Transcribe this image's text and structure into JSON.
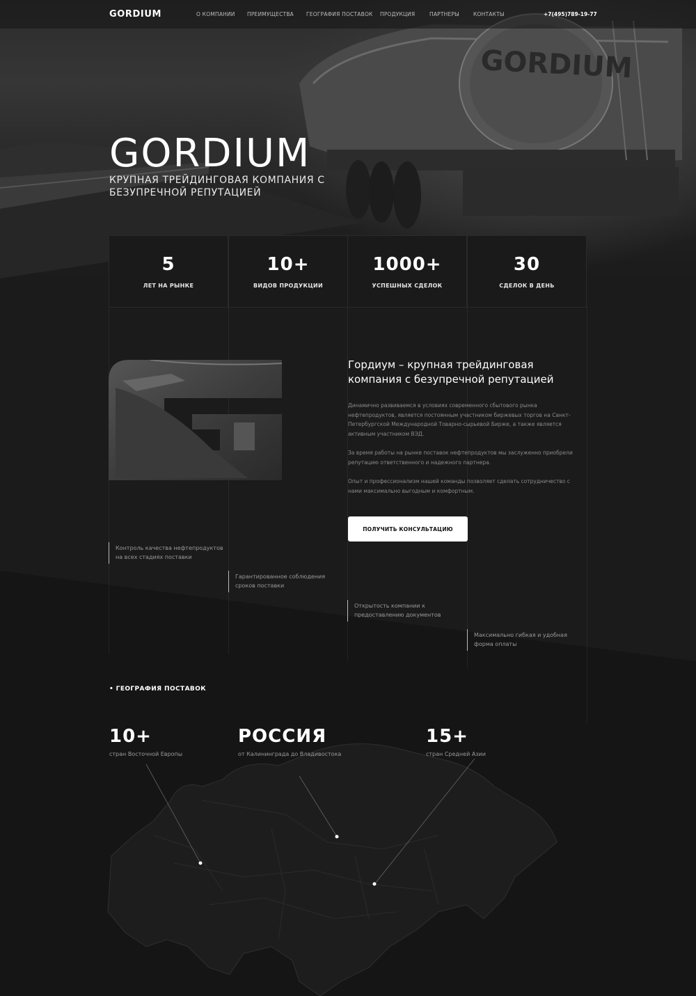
{
  "nav": {
    "logo": "GORDIUM",
    "items": [
      "О КОМПАНИИ",
      "ПРЕИМУЩЕСТВА",
      "ГЕОГРАФИЯ ПОСТАВОК",
      "ПРОДУКЦИЯ",
      "ПАРТНЕРЫ",
      "КОНТАКТЫ"
    ],
    "phone": "+7(495)789-19-77"
  },
  "hero": {
    "title": "GORDIUM",
    "subtitle": "КРУПНАЯ ТРЕЙДИНГОВАЯ КОМПАНИЯ С БЕЗУПРЕЧНОЙ РЕПУТАЦИЕЙ",
    "tank_lettering": "GORDIUM"
  },
  "stats": [
    {
      "value": "5",
      "label": "ЛЕТ НА РЫНКЕ"
    },
    {
      "value": "10+",
      "label": "ВИДОВ ПРОДУКЦИИ"
    },
    {
      "value": "1000+",
      "label": "УСПЕШНЫХ СДЕЛОК"
    },
    {
      "value": "30",
      "label": "СДЕЛОК В ДЕНЬ"
    }
  ],
  "about": {
    "title": "Гордиум – крупная трейдинговая компания с безупречной репутацией",
    "paragraphs": [
      "Динамично развиваемся в условиях современного сбытового рынка нефтепродуктов, является постоянным участником биржевых торгов на Санкт-Петербургской Международной Товарно-сырьевой Бирже, а также является активным участником ВЭД.",
      "За время работы на рынке поставок нефтепродуктов мы заслуженно приобрели репутацию ответственного и надежного партнера.",
      "Опыт и профессионализм нашей команды позволяет сделать сотрудничество с нами максимально выгодным и комфортным."
    ],
    "button": "ПОЛУЧИТЬ КОНСУЛЬТАЦИЮ"
  },
  "features": [
    "Контроль качества нефтепродуктов на всех стадиях поставки",
    "Гарантированное соблюдения сроков поставки",
    "Открытость компании к предоставлению документов",
    "Максимально гибкая и удобная форма оплаты"
  ],
  "geo": {
    "heading": "• ГЕОГРАФИЯ ПОСТАВОК",
    "items": [
      {
        "value": "10+",
        "desc": "стран Восточной Европы"
      },
      {
        "value": "РОССИЯ",
        "desc": "от Калининграда до Владивостока"
      },
      {
        "value": "15+",
        "desc": "стран Средней Азии"
      }
    ]
  },
  "colors": {
    "background": "#1b1b1b",
    "button_bg": "#ffffff",
    "button_text": "#111111",
    "muted_text": "#8a8a8a"
  }
}
